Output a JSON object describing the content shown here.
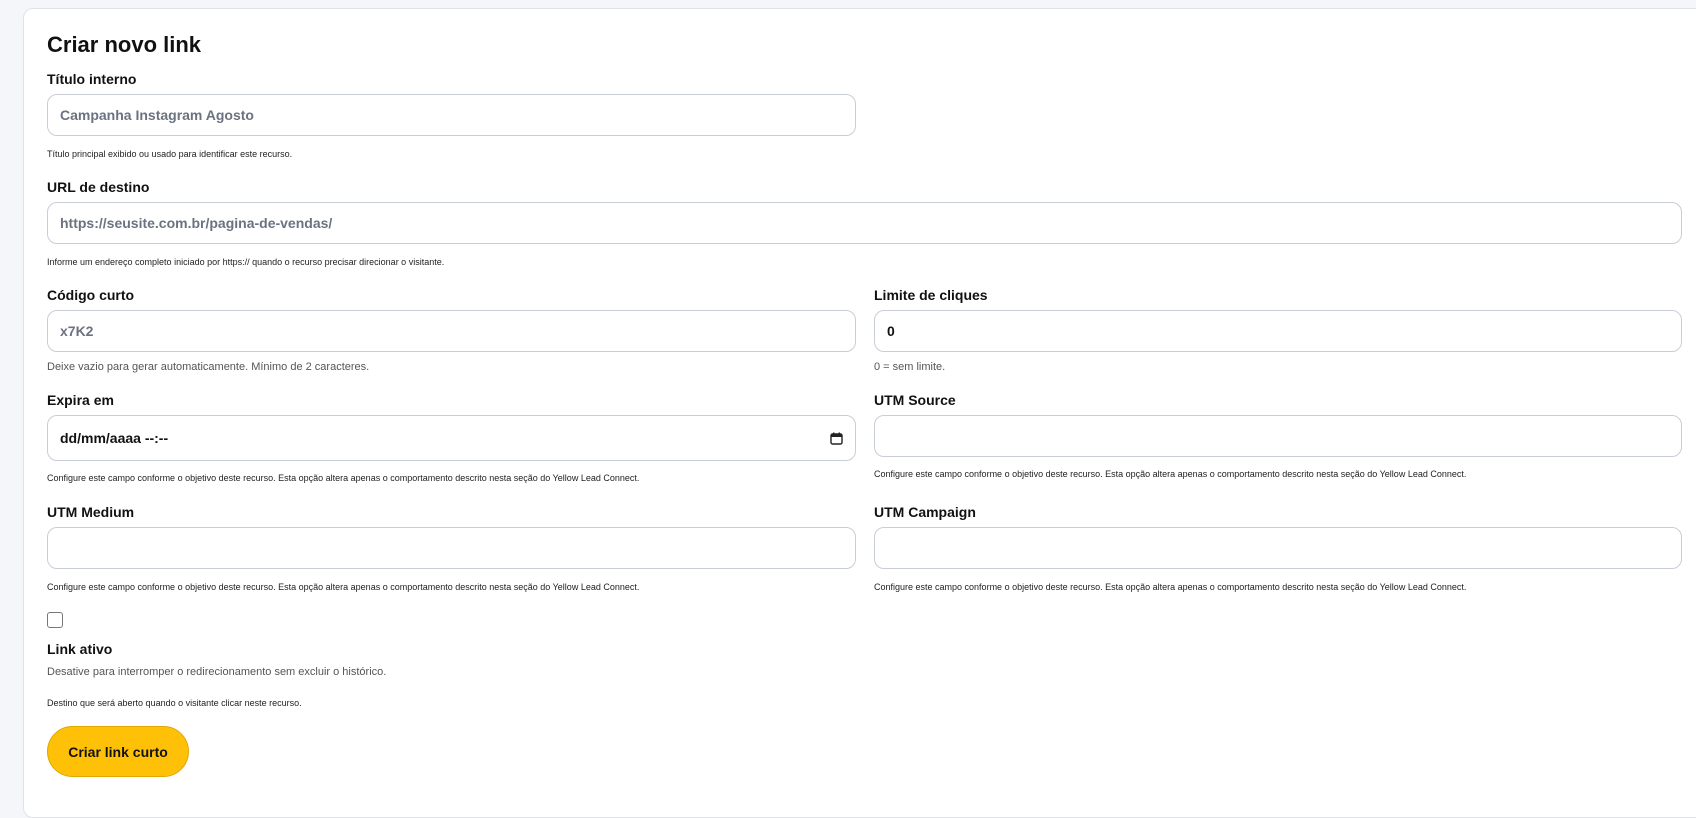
{
  "form": {
    "title": "Criar novo link",
    "internal_title": {
      "label": "Título interno",
      "placeholder": "Campanha Instagram Agosto",
      "help": "Título principal exibido ou usado para identificar este recurso."
    },
    "destination_url": {
      "label": "URL de destino",
      "placeholder": "https://seusite.com.br/pagina-de-vendas/",
      "help": "Informe um endereço completo iniciado por https:// quando o recurso precisar direcionar o visitante."
    },
    "short_code": {
      "label": "Código curto",
      "placeholder": "x7K2",
      "help": "Deixe vazio para gerar automaticamente. Mínimo de 2 caracteres."
    },
    "click_limit": {
      "label": "Limite de cliques",
      "value": "0",
      "help": "0 = sem limite."
    },
    "expires_at": {
      "label": "Expira em",
      "display": "dd/mm/aaaa  --:--",
      "help": "Configure este campo conforme o objetivo deste recurso. Esta opção altera apenas o comportamento descrito nesta seção do Yellow Lead Connect."
    },
    "utm_source": {
      "label": "UTM Source",
      "value": "",
      "help": "Configure este campo conforme o objetivo deste recurso. Esta opção altera apenas o comportamento descrito nesta seção do Yellow Lead Connect."
    },
    "utm_medium": {
      "label": "UTM Medium",
      "value": "",
      "help": "Configure este campo conforme o objetivo deste recurso. Esta opção altera apenas o comportamento descrito nesta seção do Yellow Lead Connect."
    },
    "utm_campaign": {
      "label": "UTM Campaign",
      "value": "",
      "help": "Configure este campo conforme o objetivo deste recurso. Esta opção altera apenas o comportamento descrito nesta seção do Yellow Lead Connect."
    },
    "active": {
      "checked": false,
      "label": "Link ativo",
      "help": "Desative para interromper o redirecionamento sem excluir o histórico.",
      "extra_help": "Destino que será aberto quando o visitante clicar neste recurso."
    },
    "submit_label": "Criar link curto"
  },
  "colors": {
    "accent": "#ffc107",
    "border": "#c9ced6"
  },
  "icons": {
    "date_picker": "calendar-icon"
  }
}
